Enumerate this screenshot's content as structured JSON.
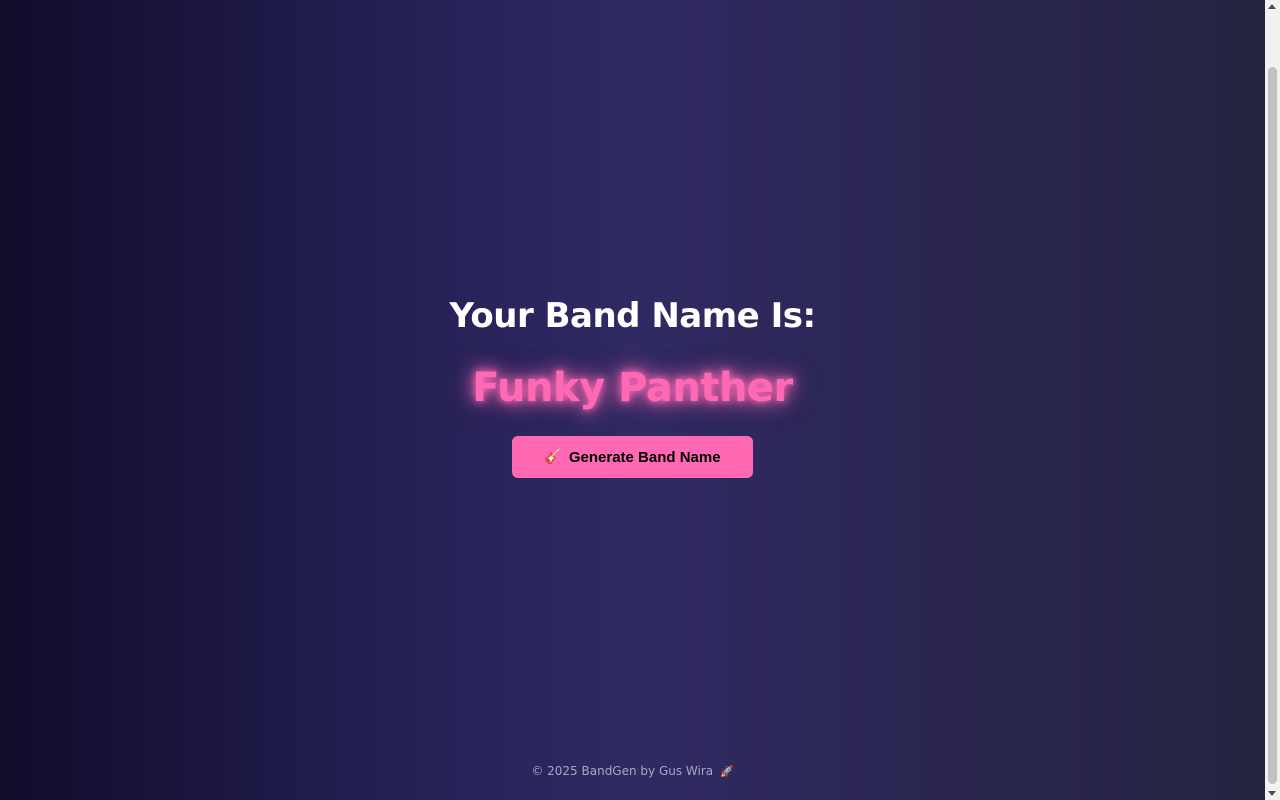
{
  "heading": "Your Band Name Is:",
  "band_name": "Funky Panther",
  "button": {
    "icon": "guitar-icon",
    "icon_glyph": "🎸",
    "label": "Generate Band Name"
  },
  "footer": {
    "text": "© 2025 BandGen by Gus Wira",
    "icon": "rocket-icon",
    "icon_glyph": "🚀"
  },
  "colors": {
    "accent": "#ff69b4",
    "background_start": "#100c2a",
    "background_mid": "#302a63",
    "background_end": "#24233f",
    "heading": "#ffffff"
  }
}
